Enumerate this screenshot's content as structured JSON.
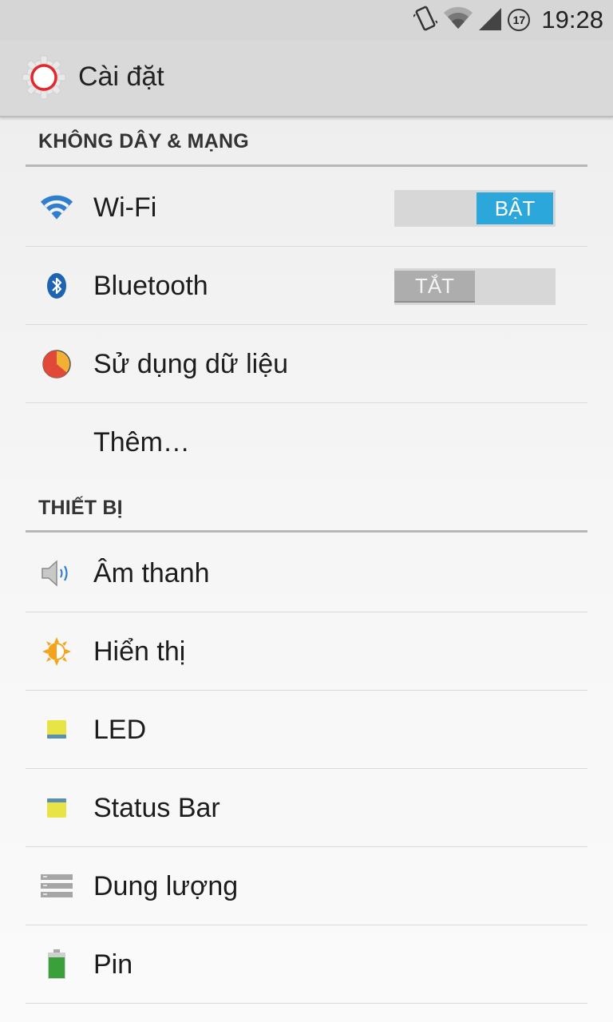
{
  "status_bar": {
    "time": "19:28",
    "badge": "17"
  },
  "action_bar": {
    "title": "Cài đặt"
  },
  "sections": {
    "wireless": {
      "header": "KHÔNG DÂY & MẠNG"
    },
    "device": {
      "header": "THIẾT BỊ"
    }
  },
  "items": {
    "wifi": {
      "label": "Wi-Fi",
      "toggle": "BẬT",
      "icon": "wifi-icon"
    },
    "bluetooth": {
      "label": "Bluetooth",
      "toggle": "TẮT",
      "icon": "bluetooth-icon"
    },
    "data_usage": {
      "label": "Sử dụng dữ liệu",
      "icon": "data-usage-icon"
    },
    "more": {
      "label": "Thêm…"
    },
    "sound": {
      "label": "Âm thanh",
      "icon": "speaker-icon"
    },
    "display": {
      "label": "Hiển thị",
      "icon": "brightness-icon"
    },
    "led": {
      "label": "LED",
      "icon": "led-icon"
    },
    "status_bar": {
      "label": "Status Bar",
      "icon": "status-bar-icon"
    },
    "storage": {
      "label": "Dung lượng",
      "icon": "storage-icon"
    },
    "battery": {
      "label": "Pin",
      "icon": "battery-icon"
    }
  },
  "colors": {
    "accent": "#2ba7dc",
    "toggle_off": "#adadad"
  }
}
